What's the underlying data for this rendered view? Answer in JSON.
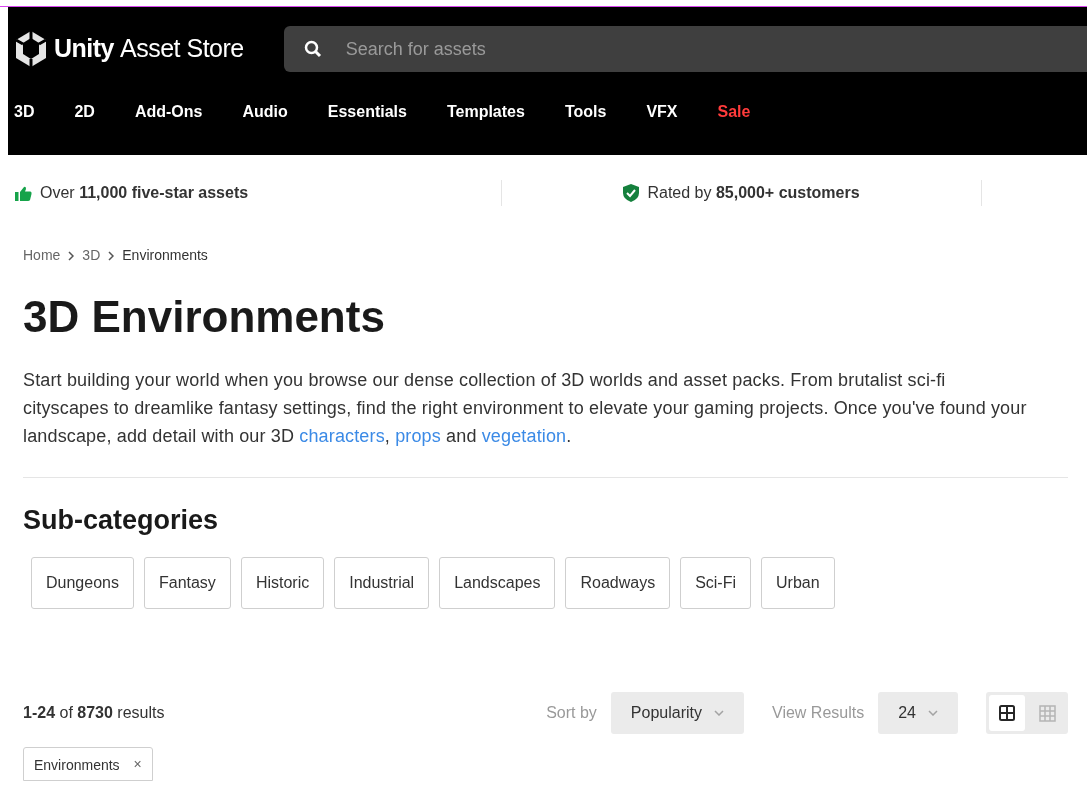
{
  "header": {
    "logo": {
      "brand": "Unity",
      "product": "Asset Store"
    },
    "search": {
      "placeholder": "Search for assets"
    },
    "nav": [
      {
        "label": "3D",
        "kind": "normal"
      },
      {
        "label": "2D",
        "kind": "normal"
      },
      {
        "label": "Add-Ons",
        "kind": "normal"
      },
      {
        "label": "Audio",
        "kind": "normal"
      },
      {
        "label": "Essentials",
        "kind": "normal"
      },
      {
        "label": "Templates",
        "kind": "normal"
      },
      {
        "label": "Tools",
        "kind": "normal"
      },
      {
        "label": "VFX",
        "kind": "normal"
      },
      {
        "label": "Sale",
        "kind": "sale"
      }
    ]
  },
  "stats": [
    {
      "kind": "thumb",
      "text": "Over **11,000 five-star assets**"
    },
    {
      "kind": "shield",
      "text": "Rated by **85,000+ customers**"
    }
  ],
  "breadcrumb": [
    "Home",
    "3D",
    "Environments"
  ],
  "title": "3D Environments",
  "description": [
    {
      "text": "Start building your world when you browse our dense collection of 3D worlds and asset packs. From brutalist sci-fi cityscapes to dreamlike fantasy settings, find the right environment to elevate your gaming projects. Once you've found your landscape, add detail with our 3D ",
      "link": false
    },
    {
      "text": "characters",
      "link": true
    },
    {
      "text": ", ",
      "link": false
    },
    {
      "text": "props",
      "link": true
    },
    {
      "text": " and ",
      "link": false
    },
    {
      "text": "vegetation",
      "link": true
    },
    {
      "text": ".",
      "link": false
    }
  ],
  "subcategories": {
    "heading": "Sub-categories",
    "items": [
      "Dungeons",
      "Fantasy",
      "Historic",
      "Industrial",
      "Landscapes",
      "Roadways",
      "Sci-Fi",
      "Urban"
    ]
  },
  "results": {
    "count": "**1-24** of **8730** results",
    "sort": {
      "label": "Sort by",
      "value": "Popularity"
    },
    "view_results": {
      "label": "View Results",
      "value": "24"
    },
    "view_toggle": [
      {
        "kind": "large",
        "selected": true
      },
      {
        "kind": "small",
        "selected": false
      }
    ]
  },
  "filters": [
    {
      "label": "Environments",
      "remove": "×"
    }
  ]
}
